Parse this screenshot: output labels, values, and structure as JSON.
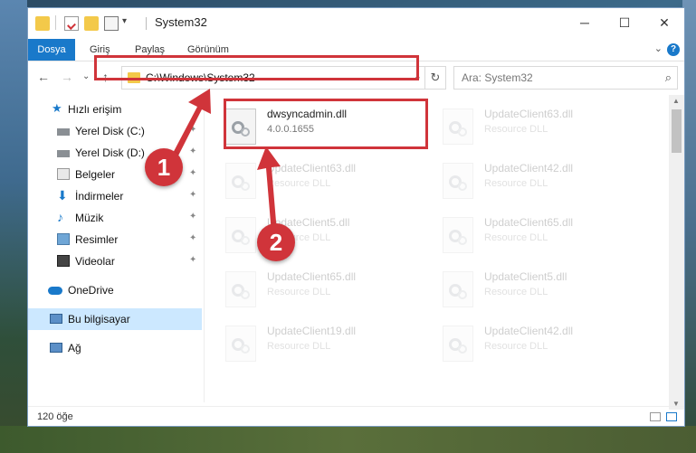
{
  "window": {
    "title": "System32",
    "minimize": "─",
    "maximize": "☐",
    "close": "✕"
  },
  "ribbon": {
    "tabs": [
      "Dosya",
      "Giriş",
      "Paylaş",
      "Görünüm"
    ],
    "help": "?",
    "collapse": "⌄"
  },
  "nav": {
    "back": "←",
    "forward": "→",
    "recent": "⌄",
    "up": "↑",
    "address": "C:\\Windows\\System32",
    "address_dropdown": "⌄",
    "refresh": "↻",
    "search_placeholder": "Ara: System32",
    "search_icon": "⌕"
  },
  "sidebar": {
    "items": [
      {
        "label": "Hızlı erişim",
        "icon": "star-icon"
      },
      {
        "label": "Yerel Disk (C:)",
        "icon": "drive-icon",
        "pinned": true
      },
      {
        "label": "Yerel Disk (D:)",
        "icon": "drive-icon",
        "pinned": true
      },
      {
        "label": "Belgeler",
        "icon": "documents-icon",
        "pinned": true
      },
      {
        "label": "İndirmeler",
        "icon": "download-icon",
        "pinned": true
      },
      {
        "label": "Müzik",
        "icon": "music-icon",
        "pinned": true
      },
      {
        "label": "Resimler",
        "icon": "pictures-icon",
        "pinned": true
      },
      {
        "label": "Videolar",
        "icon": "video-icon",
        "pinned": true
      },
      {
        "label": "OneDrive",
        "icon": "cloud-icon"
      },
      {
        "label": "Bu bilgisayar",
        "icon": "computer-icon",
        "selected": true
      },
      {
        "label": "Ağ",
        "icon": "network-icon"
      }
    ],
    "pin_glyph": "📌"
  },
  "files": [
    {
      "name": "dwsyncadmin.dll",
      "type": "4.0.0.1655"
    },
    {
      "name": "UpdateClient63.dll",
      "type": "Resource DLL"
    },
    {
      "name": "UpdateClient63.dll",
      "type": "Resource DLL"
    },
    {
      "name": "UpdateClient42.dll",
      "type": "Resource DLL"
    },
    {
      "name": "UpdateClient5.dll",
      "type": "Resource DLL"
    },
    {
      "name": "UpdateClient65.dll",
      "type": "Resource DLL"
    },
    {
      "name": "UpdateClient65.dll",
      "type": "Resource DLL"
    },
    {
      "name": "UpdateClient5.dll",
      "type": "Resource DLL"
    },
    {
      "name": "UpdateClient19.dll",
      "type": "Resource DLL"
    },
    {
      "name": "UpdateClient42.dll",
      "type": "Resource DLL"
    }
  ],
  "status": {
    "count": "120 öğe"
  },
  "callouts": {
    "one": "1",
    "two": "2"
  },
  "colors": {
    "accent": "#1979ca",
    "highlight": "#d0343a",
    "selected_bg": "#cce8ff"
  }
}
